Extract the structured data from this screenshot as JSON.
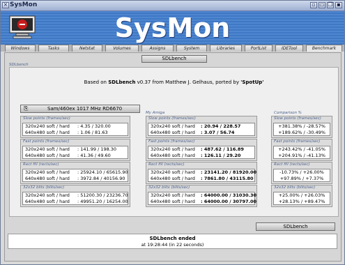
{
  "window": {
    "title": "SysMon",
    "brand": "SysMon"
  },
  "tabs": [
    {
      "label": "Windows"
    },
    {
      "label": "Tasks"
    },
    {
      "label": "Netstat"
    },
    {
      "label": "Volumes"
    },
    {
      "label": "Assigns"
    },
    {
      "label": "System"
    },
    {
      "label": "Libraries"
    },
    {
      "label": "PortList"
    },
    {
      "label": "IDETool"
    },
    {
      "label": "Benchmark"
    }
  ],
  "toolbar": {
    "sdlbench_tab": "SDLbench"
  },
  "section": {
    "label": "SDLbench"
  },
  "info": {
    "prefix": "Based on ",
    "name": "SDLbench",
    "suffix": " v0.37 from Matthew J. Gelhaus, ported by ",
    "porter": "'SpotUp'"
  },
  "selector": {
    "label": "Sam/460ex 1017 MHz RD6670"
  },
  "my_amiga_label": "My Amiga",
  "comparison_label": "Comparison %",
  "groups": [
    {
      "title": "Slow points (frames/sec)"
    },
    {
      "title": "Fast points (frames/sec)"
    },
    {
      "title": "Rect fill (rects/sec)"
    },
    {
      "title": "32x32 blits (blits/sec)"
    }
  ],
  "ref": [
    {
      "l1": "320x240 soft / hard",
      "v1": ": 4.35 / 320.00",
      "l2": "640x480 soft / hard",
      "v2": ": 1.06 / 81.63"
    },
    {
      "l1": "320x240 soft / hard",
      "v1": ": 141.99 / 198.30",
      "l2": "640x480 soft / hard",
      "v2": ": 41.36 / 49.60"
    },
    {
      "l1": "320x240 soft / hard",
      "v1": ": 25924.10 / 65615.90",
      "l2": "640x480 soft / hard",
      "v2": ": 3972.84 / 40156.90"
    },
    {
      "l1": "320x240 soft / hard",
      "v1": ": 51200.30 / 23236.70",
      "l2": "640x480 soft / hard",
      "v2": ": 49951.20 / 16254.00"
    }
  ],
  "mine": [
    {
      "l1": "320x240 soft / hard",
      "v1": ": 20.94 / 228.57",
      "l2": "640x480 soft / hard",
      "v2": ": 3.07 / 56.74"
    },
    {
      "l1": "320x240 soft / hard",
      "v1": ": 487.62 / 116.89",
      "l2": "640x480 soft / hard",
      "v2": ": 126.11 / 29.20"
    },
    {
      "l1": "320x240 soft / hard",
      "v1": ": 23141.20 / 81920.00",
      "l2": "640x480 soft / hard",
      "v2": ": 7861.80 / 43115.80"
    },
    {
      "l1": "320x240 soft / hard",
      "v1": ": 64000.00 / 31030.30",
      "l2": "640x480 soft / hard",
      "v2": ": 64000.00 / 30797.00"
    }
  ],
  "comp": [
    {
      "v1": "+381.38% / -28.57%",
      "v2": "+189.62% / -30.49%"
    },
    {
      "v1": "+243.42% / -41.05%",
      "v2": "+204.91% / -41.13%"
    },
    {
      "v1": "-10.73% / +26.00%",
      "v2": "+97.89% / +7.37%"
    },
    {
      "v1": "+25.00% / +26.03%",
      "v2": "+28.13% / +89.47%"
    }
  ],
  "run_button": {
    "label": "SDLbench"
  },
  "status": {
    "line1": "SDLbench ended",
    "line2": "at 19:28:44 (in 22 seconds)"
  }
}
